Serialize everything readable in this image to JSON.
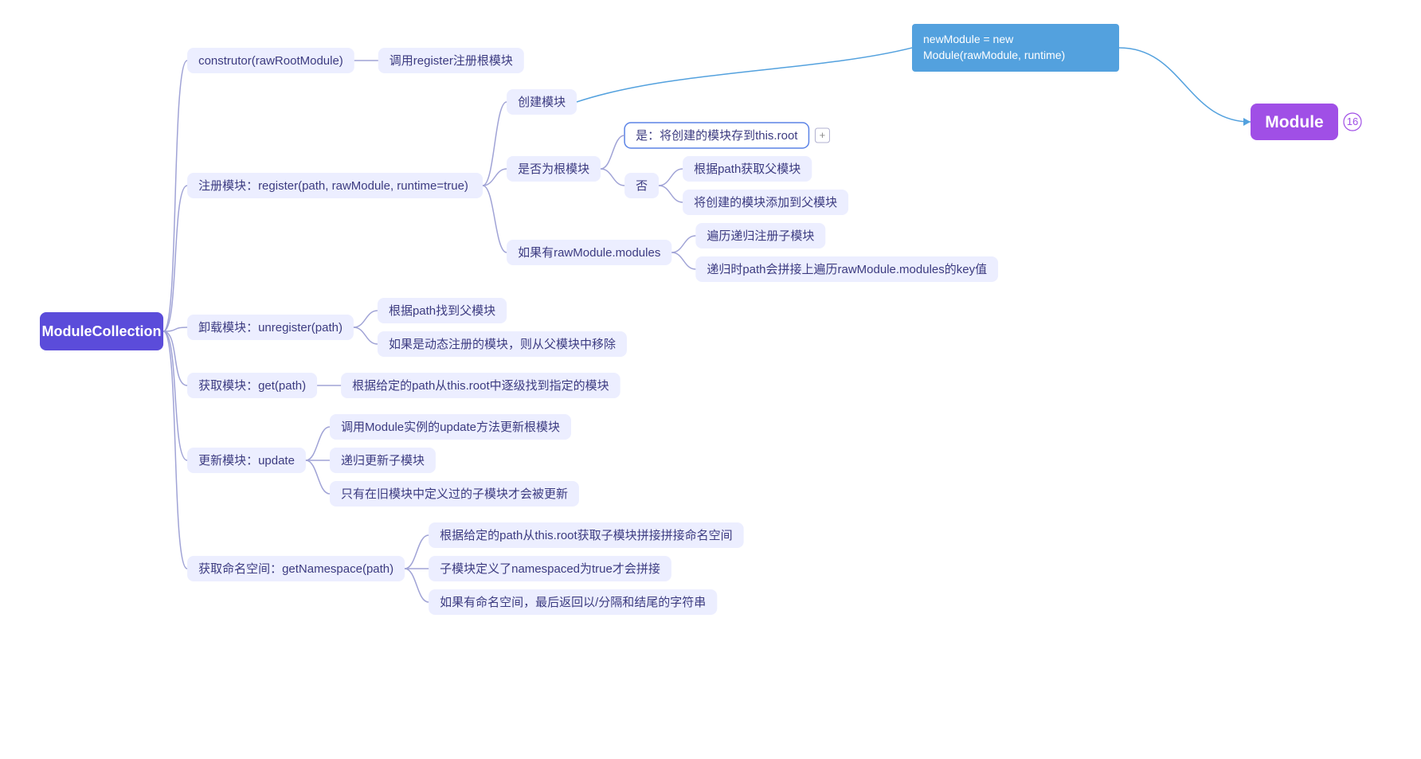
{
  "root": "ModuleCollection",
  "c": [
    {
      "t": "construtor(rawRootModule)",
      "c": [
        {
          "t": "调用register注册根模块"
        }
      ]
    },
    {
      "t": "注册模块：register(path, rawModule,  runtime=true)",
      "c": [
        {
          "t": "创建模块"
        },
        {
          "t": "是否为根模块",
          "c": [
            {
              "t": "是：将创建的模块存到this.root",
              "sel": true,
              "plus": true
            },
            {
              "t": "否",
              "c": [
                {
                  "t": "根据path获取父模块"
                },
                {
                  "t": "将创建的模块添加到父模块"
                }
              ]
            }
          ]
        },
        {
          "t": "如果有rawModule.modules",
          "c": [
            {
              "t": "遍历递归注册子模块"
            },
            {
              "t": "递归时path会拼接上遍历rawModule.modules的key值"
            }
          ]
        }
      ]
    },
    {
      "t": "卸载模块：unregister(path)",
      "c": [
        {
          "t": "根据path找到父模块"
        },
        {
          "t": "如果是动态注册的模块，则从父模块中移除"
        }
      ]
    },
    {
      "t": "获取模块：get(path)",
      "c": [
        {
          "t": "根据给定的path从this.root中逐级找到指定的模块"
        }
      ]
    },
    {
      "t": "更新模块：update",
      "c": [
        {
          "t": "调用Module实例的update方法更新根模块"
        },
        {
          "t": "递归更新子模块"
        },
        {
          "t": "只有在旧模块中定义过的子模块才会被更新"
        }
      ]
    },
    {
      "t": "获取命名空间：getNamespace(path)",
      "c": [
        {
          "t": "根据给定的path从this.root获取子模块拼接拼接命名空间"
        },
        {
          "t": "子模块定义了namespaced为true才会拼接"
        },
        {
          "t": "如果有命名空间，最后返回以/分隔和结尾的字符串"
        }
      ]
    }
  ],
  "tip": "newModule = new Module(rawModule, runtime)",
  "target": "Module",
  "count": "16"
}
